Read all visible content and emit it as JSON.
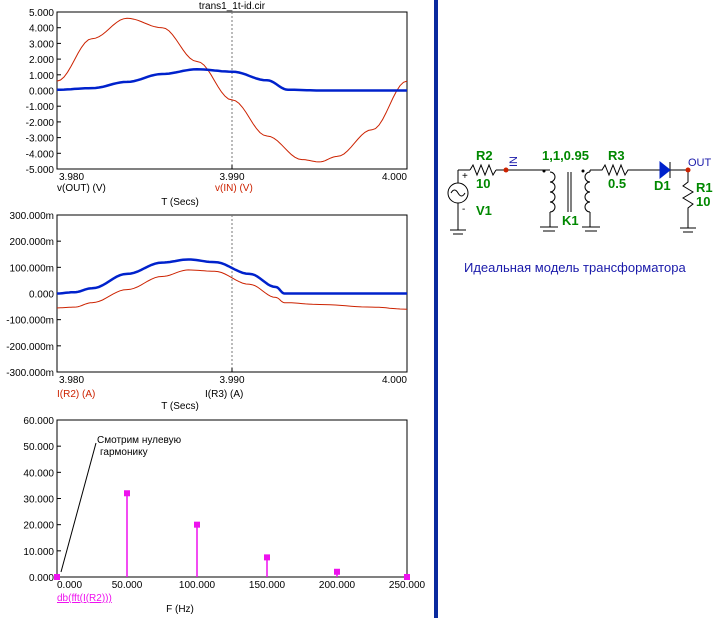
{
  "colors": {
    "red": "#cc2200",
    "blue": "#0022cc",
    "magenta": "#ee11ee",
    "green": "#008800",
    "divider": "#0a2a9e",
    "label_blue": "#1a1aaa"
  },
  "file_title": "trans1_1t-id.cir",
  "chart_data": [
    {
      "type": "line",
      "title": "trans1_1t-id.cir",
      "xlabel": "T (Secs)",
      "xlim": [
        3.98,
        4.0
      ],
      "ylim": [
        -5,
        5
      ],
      "x_ticks": [
        "3.980",
        "3.990",
        "4.000"
      ],
      "y_ticks": [
        "5.000",
        "4.000",
        "3.000",
        "2.000",
        "1.000",
        "0.000",
        "-1.000",
        "-2.000",
        "-3.000",
        "-4.000",
        "-5.000"
      ],
      "grid": "dotted center vertical line",
      "series": [
        {
          "name": "v(OUT) (V)",
          "color": "#0022cc",
          "x": [
            3.98,
            3.982,
            3.984,
            3.986,
            3.988,
            3.99,
            3.992,
            3.9932,
            3.995,
            3.998,
            4.0
          ],
          "y": [
            0.05,
            0.15,
            0.55,
            1.05,
            1.35,
            1.2,
            0.65,
            0.05,
            0.0,
            0.0,
            0.0
          ]
        },
        {
          "name": "v(IN) (V)",
          "color": "#cc2200",
          "x": [
            3.98,
            3.982,
            3.984,
            3.986,
            3.988,
            3.99,
            3.992,
            3.994,
            3.995,
            3.996,
            3.998,
            4.0
          ],
          "y": [
            0.6,
            3.3,
            4.6,
            4.0,
            1.85,
            -0.6,
            -2.9,
            -4.4,
            -4.55,
            -4.2,
            -2.5,
            0.6
          ]
        }
      ]
    },
    {
      "type": "line",
      "xlabel": "T (Secs)",
      "xlim": [
        3.98,
        4.0
      ],
      "ylim": [
        -300,
        300
      ],
      "y_unit": "m",
      "x_ticks": [
        "3.980",
        "3.990",
        "4.000"
      ],
      "y_ticks": [
        "300.000m",
        "200.000m",
        "100.000m",
        "0.000",
        "-100.000m",
        "-200.000m",
        "-300.000m"
      ],
      "grid": "dotted center vertical line",
      "series": [
        {
          "name": "I(R2) (A)",
          "color": "#cc2200",
          "x": [
            3.98,
            3.981,
            3.982,
            3.984,
            3.986,
            3.9875,
            3.989,
            3.991,
            3.9925,
            3.993,
            3.995,
            3.998,
            4.0
          ],
          "y": [
            -55,
            -52,
            -35,
            15,
            65,
            90,
            85,
            35,
            -15,
            -35,
            -42,
            -52,
            -60
          ]
        },
        {
          "name": "I(R3) (A)",
          "color": "#0022cc",
          "x": [
            3.98,
            3.981,
            3.982,
            3.984,
            3.986,
            3.9875,
            3.989,
            3.991,
            3.9925,
            3.993,
            3.995,
            4.0
          ],
          "y": [
            0,
            5,
            20,
            75,
            118,
            130,
            120,
            75,
            25,
            0,
            0,
            0
          ]
        }
      ]
    },
    {
      "type": "bar",
      "style": "stem",
      "xlabel": "F (Hz)",
      "xlim": [
        0,
        250
      ],
      "ylim": [
        0,
        60
      ],
      "x_ticks": [
        "0.000",
        "50.000",
        "100.000",
        "150.000",
        "200.000",
        "250.000"
      ],
      "y_ticks": [
        "60.000",
        "50.000",
        "40.000",
        "30.000",
        "20.000",
        "10.000",
        "0.000"
      ],
      "series": [
        {
          "name": "db(fft(I(R2)))",
          "color": "#ee11ee",
          "x": [
            0,
            50,
            100,
            150,
            200,
            250
          ],
          "y": [
            0,
            32,
            20,
            7.5,
            2,
            0
          ]
        }
      ],
      "annotation": {
        "line1": "Смотрим нулевую",
        "line2": "гармонику"
      }
    }
  ],
  "schematic": {
    "r2": {
      "name": "R2",
      "value": "10"
    },
    "v1": {
      "name": "V1"
    },
    "net_in": "IN",
    "k1": {
      "name": "K1",
      "value": "1,1,0.95"
    },
    "r3": {
      "name": "R3",
      "value": "0.5"
    },
    "d1": {
      "name": "D1"
    },
    "net_out": "OUT",
    "r1": {
      "name": "R1",
      "value": "10"
    },
    "caption": "Идеальная модель трансформатора"
  }
}
